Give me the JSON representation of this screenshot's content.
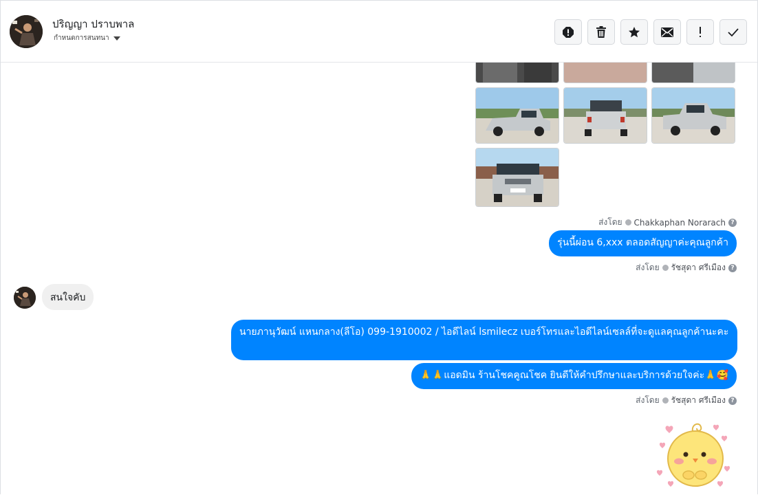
{
  "header": {
    "contact_name": "ปริญญา ปราบพาล",
    "assign_label": "กำหนดการสนทนา",
    "actions": [
      {
        "name": "spam-icon"
      },
      {
        "name": "trash-icon"
      },
      {
        "name": "star-icon"
      },
      {
        "name": "mail-icon"
      },
      {
        "name": "important-icon"
      },
      {
        "name": "check-icon"
      }
    ]
  },
  "messages": {
    "sent_by_label": "ส่งโดย",
    "meta1_name": "Chakkaphan Norarach",
    "out1_text": "รุ่นนี้ผ่อน 6,xxx ตลอดสัญญาค่ะคุณลูกค้า",
    "meta2_name": "รัชสุดา ศรีเมือง",
    "in1_text": "สนใจคับ",
    "out2_text": "นายภานุวัฒน์ แหนกลาง(ลีโอ)       099-1910002 / ไอดีไลน์ lsmilecz   เบอร์โทรและไอดีไลน์เซลล์ที่จะดูแลคุณลูกค้านะคะ",
    "out3_text": "🙏🙏แอดมิน ร้านโชคคูณโชค ยินดีให้คำปรึกษาและบริการด้วยใจค่ะ🙏🥰",
    "meta3_name": "รัชสุดา ศรีเมือง"
  },
  "colors": {
    "accent": "#0084ff",
    "incoming_bubble": "#f0f0f0"
  }
}
